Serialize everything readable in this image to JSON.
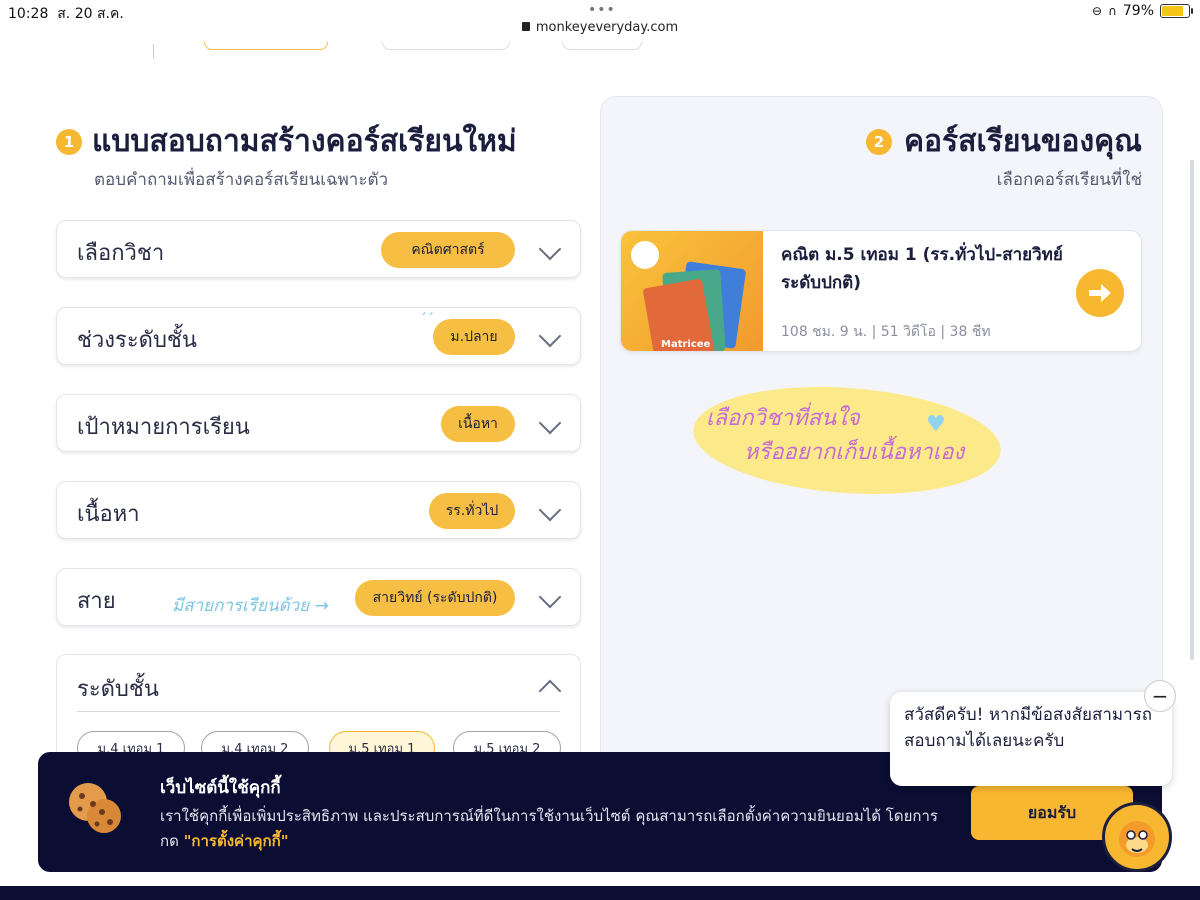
{
  "status_bar": {
    "time": "10:28",
    "date": "ส. 20 ส.ค.",
    "battery_percent": "79%",
    "battery_level": 0.79
  },
  "browser": {
    "url": "monkeyeveryday.com"
  },
  "left": {
    "step": "1",
    "title": "แบบสอบถามสร้างคอร์สเรียนใหม่",
    "subtitle": "ตอบคำถามเพื่อสร้างคอร์สเรียนเฉพาะตัว",
    "questions": [
      {
        "label": "เลือกวิชา",
        "value": "คณิตศาสตร์"
      },
      {
        "label": "ช่วงระดับชั้น",
        "value": "ม.ปลาย"
      },
      {
        "label": "เป้าหมายการเรียน",
        "value": "เนื้อหา"
      },
      {
        "label": "เนื้อหา",
        "value": "รร.ทั่วไป"
      },
      {
        "label": "สาย",
        "value": "สายวิทย์ (ระดับปกติ)"
      }
    ],
    "annotation": "มีสายการเรียนด้วย →",
    "level": {
      "label": "ระดับชั้น",
      "options": [
        "ม.4 เทอม 1",
        "ม.4 เทอม 2",
        "ม.5 เทอม 1",
        "ม.5 เทอม 2"
      ],
      "selected": "ม.5 เทอม 1"
    }
  },
  "right": {
    "step": "2",
    "title": "คอร์สเรียนของคุณ",
    "subtitle": "เลือกคอร์สเรียนที่ใช่",
    "course": {
      "title": "คณิต ม.5 เทอม 1 (รร.ทั่วไป-สายวิทย์ ระดับปกติ)",
      "meta": "108 ชม. 9 น. | 51 วิดีโอ | 38 ชีท",
      "thumb_text": "Matricee"
    },
    "annotation_line1": "เลือกวิชาที่สนใจ",
    "annotation_line2": "หรืออยากเก็บเนื้อหาเอง"
  },
  "cookie": {
    "title": "เว็บไซต์นี้ใช้คุกกี้",
    "body": "เราใช้คุกกี้เพื่อเพิ่มประสิทธิภาพ และประสบการณ์ที่ดีในการใช้งานเว็บไซต์ คุณสามารถเลือกตั้งค่าความยินยอมได้ โดยการกด",
    "link": "\"การตั้งค่าคุกกี้\"",
    "accept": "ยอมรับ"
  },
  "chat": {
    "message": "สวัสดีครับ! หากมีข้อสงสัยสามารถสอบถามได้เลยนะครับ",
    "close": "−"
  },
  "colors": {
    "accent": "#f7b731",
    "navy": "#0b0d33",
    "panel": "#f4f5fa"
  }
}
